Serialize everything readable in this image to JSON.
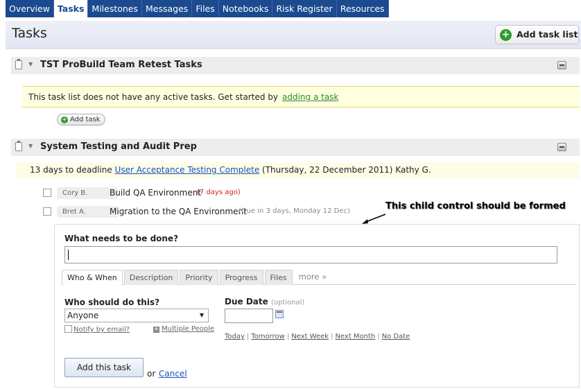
{
  "nav": {
    "tabs": [
      {
        "label": "Overview"
      },
      {
        "label": "Tasks"
      },
      {
        "label": "Milestones"
      },
      {
        "label": "Messages"
      },
      {
        "label": "Files"
      },
      {
        "label": "Notebooks"
      },
      {
        "label": "Risk Register"
      },
      {
        "label": "Resources"
      }
    ],
    "active": "Tasks"
  },
  "header": {
    "title": "Tasks",
    "add_list_label": "Add task list"
  },
  "lists": [
    {
      "name": "TST ProBuild Team Retest Tasks",
      "empty_text": "This task list does not have any active tasks. Get started by",
      "empty_link": "adding a task",
      "add_task_label": "Add task"
    },
    {
      "name": "System Testing and Audit Prep",
      "deadline": {
        "prefix": "13 days to deadline",
        "milestone": "User Acceptance Testing Complete",
        "suffix": "(Thursday, 22 December 2011) Kathy G."
      },
      "tasks": [
        {
          "assignee": "Cory B.",
          "name": "Build QA Environment",
          "meta": "(7 days ago)",
          "meta_color": "#cc2222"
        },
        {
          "assignee": "Bret A.",
          "name": "Migration to the QA Environment",
          "meta": "(Due in 3 days, Monday 12 Dec)",
          "meta_color": "#888888"
        }
      ]
    }
  ],
  "annotation": "This child control should be formed",
  "form": {
    "question": "What needs to be done?",
    "todo_value": "",
    "tabs": [
      {
        "label": "Who & When"
      },
      {
        "label": "Description"
      },
      {
        "label": "Priority"
      },
      {
        "label": "Progress"
      },
      {
        "label": "Files"
      }
    ],
    "more": "more »",
    "who_label": "Who should do this?",
    "who_value": "Anyone",
    "notify": "Notify by email?",
    "multiple": "Multiple People",
    "due_label": "Due Date",
    "due_optional": "(optional)",
    "due_value": "",
    "quick_dates": [
      "Today",
      "Tomorrow",
      "Next Week",
      "Next Month",
      "No Date"
    ],
    "submit": "Add this task",
    "or": "or",
    "cancel": "Cancel"
  }
}
